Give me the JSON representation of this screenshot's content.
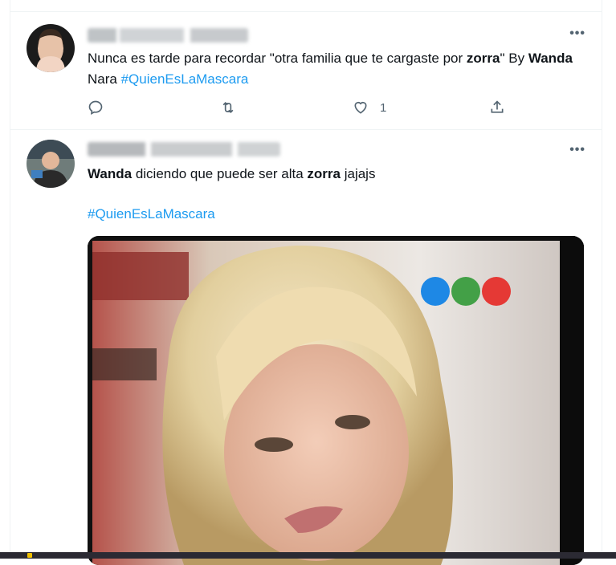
{
  "tweet1": {
    "text_parts": {
      "t1": "Nunca es tarde para recordar \"otra familia que te cargaste por ",
      "b1": "zorra",
      "t2": "\" By ",
      "b2": "Wanda",
      "t3": " Nara ",
      "hashtag": "#QuienEsLaMascara"
    },
    "actions": {
      "reply_icon": "reply-icon",
      "retweet_icon": "retweet-icon",
      "like_icon": "heart-icon",
      "like_count": "1",
      "share_icon": "share-icon"
    },
    "more_label": "•••"
  },
  "tweet2": {
    "text_parts": {
      "b1": "Wanda",
      "t1": " diciendo que puede ser alta ",
      "b2": "zorra",
      "t2": " jajajs",
      "hashtag": "#QuienEsLaMascara"
    },
    "more_label": "•••",
    "media": {
      "logo_colors": [
        "#1e88e5",
        "#43a047",
        "#e53935"
      ]
    }
  },
  "colors": {
    "link": "#1d9bf0",
    "muted": "#536471",
    "border": "#eff3f4"
  }
}
